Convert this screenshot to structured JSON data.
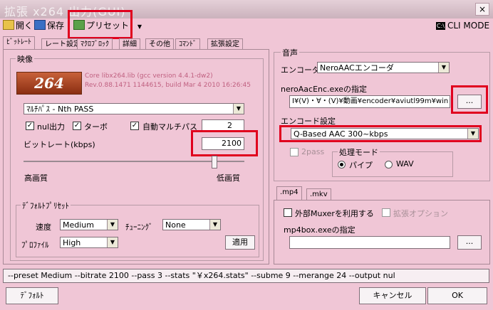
{
  "window": {
    "title": "拡張 x264 出力(GUI)",
    "close_label": "×"
  },
  "toolbar": {
    "open_label": "開く",
    "save_label": "保存",
    "preset_label": "プリセット",
    "cli_mode_label": "CLI MODE",
    "cli_icon_text": "C:\\"
  },
  "tabs": [
    "ﾋﾞｯﾄﾚｰﾄ",
    "レート設定",
    "ﾏｸﾛﾌﾞﾛｯｸ",
    "詳細",
    "その他",
    "ｺﾏﾝﾄﾞ",
    "拡張設定"
  ],
  "video": {
    "group_label": "映像",
    "logo_text": "264",
    "core_line1": "Core libx264.lib (gcc version 4.4.1-dw2)",
    "core_line2": "Rev.0.88.1471 1144615, build Mar 4 2010 16:26:45",
    "mode_value": "ﾏﾙﾁﾊﾟｽ - Nth PASS",
    "nul_output_label": "nul出力",
    "turbo_label": "ターボ",
    "auto_multipass_label": "自動マルチパス",
    "multipass_count": "2",
    "bitrate_label": "ビットレート(kbps)",
    "bitrate_value": "2100",
    "quality_high_label": "高画質",
    "quality_low_label": "低画質",
    "slider_position": 0.86
  },
  "default_preset": {
    "group_label": "ﾃﾞﾌｫﾙﾄﾌﾟﾘｾｯﾄ",
    "speed_label": "速度",
    "speed_value": "Medium",
    "tuning_label": "ﾁｭｰﾆﾝｸﾞ",
    "tuning_value": "None",
    "profile_label": "ﾌﾟﾛﾌｧｲﾙ",
    "profile_value": "High",
    "apply_label": "適用"
  },
  "audio": {
    "group_label": "音声",
    "encoder_label": "エンコーダ",
    "encoder_value": "NeroAACエンコーダ",
    "exe_label": "neroAacEnc.exeの指定",
    "exe_path": "I¥(V)・∀・(V)¥動画¥encoder¥aviutl99m¥win",
    "browse_label": "...",
    "encode_settings_label": "エンコード設定",
    "encode_settings_value": "Q-Based AAC 300~kbps",
    "twopass_label": "2pass",
    "process_mode_label": "処理モード",
    "pipe_label": "パイプ",
    "wav_label": "WAV"
  },
  "mux": {
    "tabs": [
      ".mp4",
      ".mkv"
    ],
    "external_muxer_label": "外部Muxerを利用する",
    "extended_option_label": "拡張オプション",
    "mp4box_label": "mp4box.exeの指定",
    "mp4box_path": "",
    "browse_label": "..."
  },
  "command_line": "--preset Medium --bitrate 2100 --pass 3 --stats \"￥x264.stats\" --subme 9 --merange 24 --output nul",
  "footer": {
    "default_label": "ﾃﾞﾌｫﾙﾄ",
    "cancel_label": "キャンセル",
    "ok_label": "OK"
  },
  "colors": {
    "window_bg": "#f0c6d6",
    "highlight": "#e0001e",
    "encode_select_bg": "#ffffff"
  }
}
